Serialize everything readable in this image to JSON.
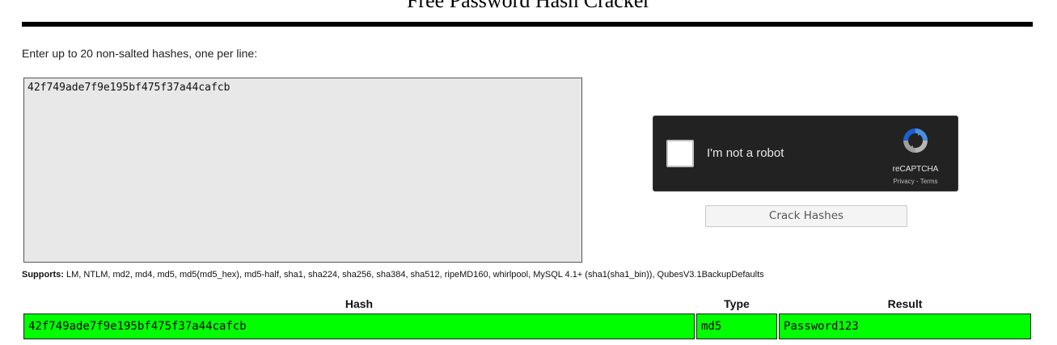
{
  "page_title": "Free Password Hash Cracker",
  "instructions": "Enter up to 20 non-salted hashes, one per line:",
  "hash_input_value": "42f749ade7f9e195bf475f37a44cafcb",
  "recaptcha": {
    "label": "I'm not a robot",
    "brand": "reCAPTCHA",
    "links": "Privacy - Terms",
    "checked": false
  },
  "crack_button_label": "Crack Hashes",
  "supports": {
    "label": "Supports:",
    "text": "LM, NTLM, md2, md4, md5, md5(md5_hex), md5-half, sha1, sha224, sha256, sha384, sha512, ripeMD160, whirlpool, MySQL 4.1+ (sha1(sha1_bin)), QubesV3.1BackupDefaults"
  },
  "results": {
    "columns": [
      "Hash",
      "Type",
      "Result"
    ],
    "rows": [
      {
        "hash": "42f749ade7f9e195bf475f37a44cafcb",
        "type": "md5",
        "result": "Password123",
        "status_color": "#00ff00"
      }
    ]
  },
  "colors": {
    "found_row": "#00ff00",
    "recaptcha_bg": "#222222",
    "textarea_bg": "#e8e8e8"
  },
  "icons": {
    "recaptcha_logo": "recaptcha-logo-icon"
  }
}
